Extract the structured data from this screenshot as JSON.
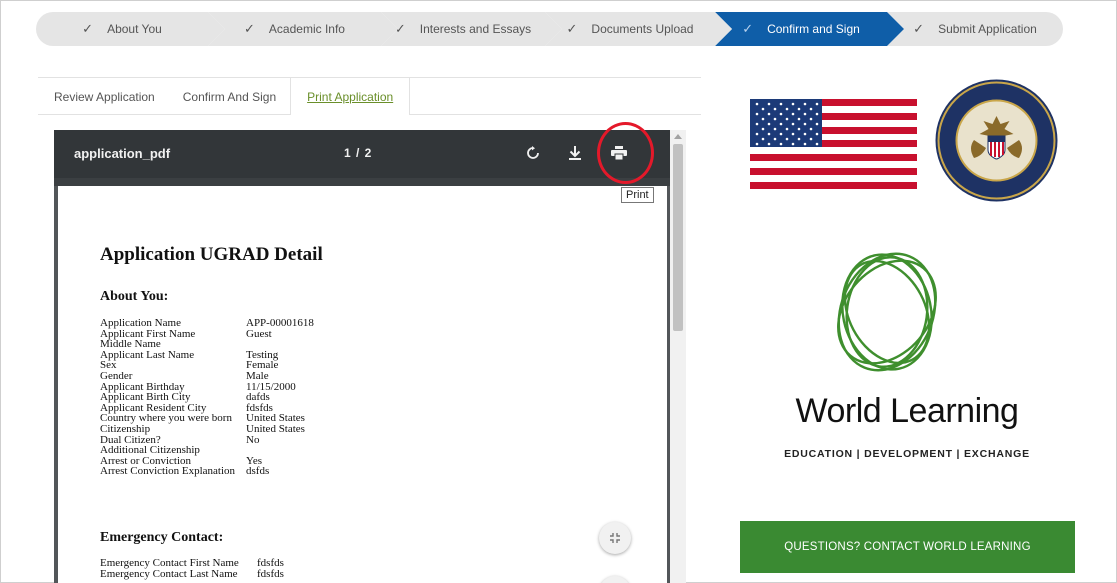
{
  "steps": [
    {
      "label": "About You",
      "active": false
    },
    {
      "label": "Academic Info",
      "active": false
    },
    {
      "label": "Interests and Essays",
      "active": false
    },
    {
      "label": "Documents Upload",
      "active": false
    },
    {
      "label": "Confirm and Sign",
      "active": true
    },
    {
      "label": "Submit Application",
      "active": false
    }
  ],
  "tabs": [
    {
      "label": "Review Application"
    },
    {
      "label": "Confirm And Sign"
    },
    {
      "label": "Print Application"
    }
  ],
  "viewer": {
    "filename": "application_pdf",
    "page_indicator": "1 / 2",
    "tooltip": "Print"
  },
  "document": {
    "title": "Application UGRAD Detail",
    "section1": "About You:",
    "section1_rows": [
      {
        "k": "Application Name",
        "v": "APP-00001618"
      },
      {
        "k": "Applicant First Name",
        "v": "Guest"
      },
      {
        "k": "Middle Name",
        "v": ""
      },
      {
        "k": "Applicant Last Name",
        "v": "Testing"
      },
      {
        "k": "Sex",
        "v": "Female"
      },
      {
        "k": "Gender",
        "v": "Male"
      },
      {
        "k": "Applicant Birthday",
        "v": "11/15/2000"
      },
      {
        "k": "Applicant Birth City",
        "v": "dafds"
      },
      {
        "k": "Applicant Resident City",
        "v": "fdsfds"
      },
      {
        "k": "Country where you were born",
        "v": "United States"
      },
      {
        "k": "Citizenship",
        "v": "United States"
      },
      {
        "k": "Dual Citizen?",
        "v": "No"
      },
      {
        "k": "Additional Citizenship",
        "v": ""
      },
      {
        "k": "Arrest or Conviction",
        "v": "Yes"
      },
      {
        "k": "Arrest Conviction Explanation",
        "v": "dsfds"
      }
    ],
    "section2": "Emergency Contact:",
    "section2_rows": [
      {
        "k": "Emergency Contact First Name",
        "v": "fdsfds"
      },
      {
        "k": "Emergency Contact Last Name",
        "v": "fdsfds"
      }
    ]
  },
  "brand": {
    "title": "World Learning",
    "subtitle": "EDUCATION | DEVELOPMENT | EXCHANGE",
    "cta": "QUESTIONS? CONTACT WORLD LEARNING",
    "green": "#3a8a32",
    "accent_blue": "#0f5ea8",
    "highlight_red": "#e4192a"
  }
}
